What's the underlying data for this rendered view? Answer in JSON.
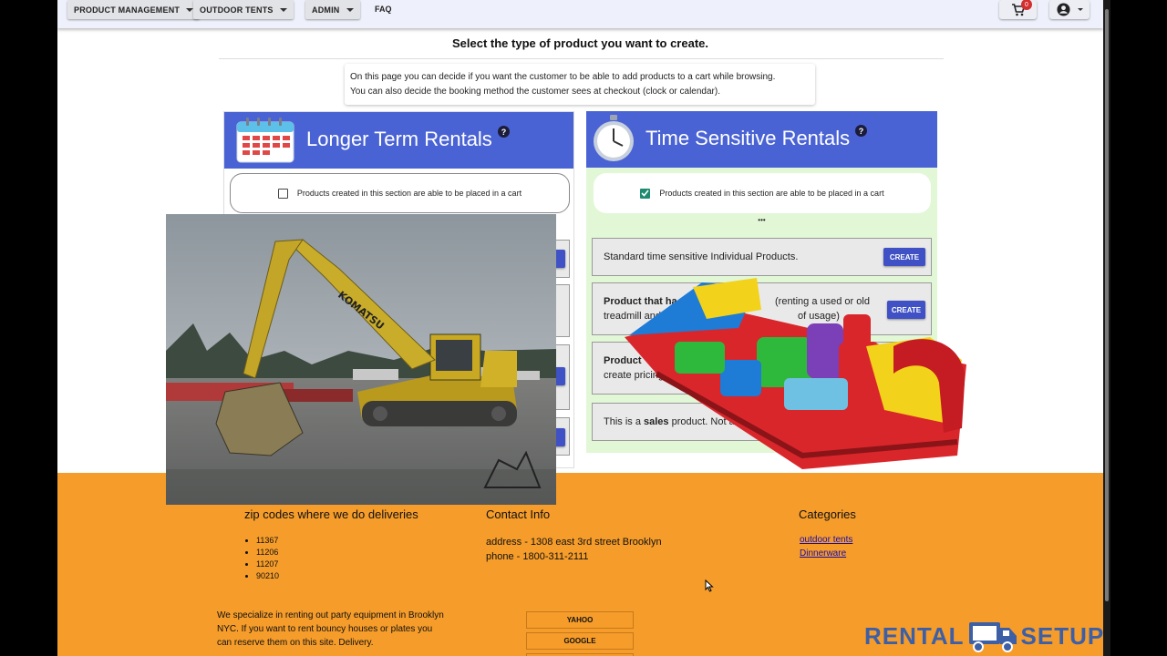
{
  "nav": {
    "product_management": "PRODUCT MANAGEMENT",
    "outdoor_tents": "OUTDOOR TENTS",
    "admin": "ADMIN",
    "faq": "FAQ",
    "cart_count": "0"
  },
  "page": {
    "title": "Select the type of product you want to create.",
    "info_line1": "On this page you can decide if you want the customer to be able to add products to a cart while browsing.",
    "info_line2": "You can also decide the booking method the customer sees at checkout (clock or calendar)."
  },
  "long_term": {
    "title": "Longer Term Rentals",
    "help": "?",
    "cart_label": "Products created in this section are able to be placed in a cart",
    "cart_checked": false
  },
  "time_sensitive": {
    "title": "Time Sensitive Rentals",
    "help": "?",
    "cart_label": "Products created in this section are able to be placed in a cart",
    "cart_checked": true,
    "dots": "•••",
    "rows": [
      {
        "text": "Standard time sensitive Individual Products.",
        "button": "CREATE"
      },
      {
        "bold": "Product that ha",
        "text": "(renting a used or old",
        "text2": "treadmill and",
        "text3": "of usage)",
        "button": "CREATE"
      },
      {
        "bold": "Product",
        "text2": "create pricing ta"
      },
      {
        "text": "This is a ",
        "bold": "sales",
        "text2": " product. Not a rental"
      }
    ]
  },
  "footer": {
    "zip_heading": "zip codes where we do deliveries",
    "zips": [
      "11367",
      "11206",
      "11207",
      "90210"
    ],
    "contact_heading": "Contact Info",
    "address": "address - 1308 east 3rd street Brooklyn",
    "phone": "phone - 1800-311-2111",
    "categories_heading": "Categories",
    "categories": [
      "outdoor tents",
      "Dinnerware"
    ],
    "about": "We specialize in renting out party equipment in Brooklyn NYC. If you want to rent bouncy houses or plates you can reserve them on this site. Delivery.",
    "search_buttons": [
      "YAHOO",
      "GOOGLE"
    ],
    "brand_left": "RENTAL",
    "brand_right": "SETUP"
  },
  "overlay": {
    "excavator_label": "KOMATSU"
  }
}
